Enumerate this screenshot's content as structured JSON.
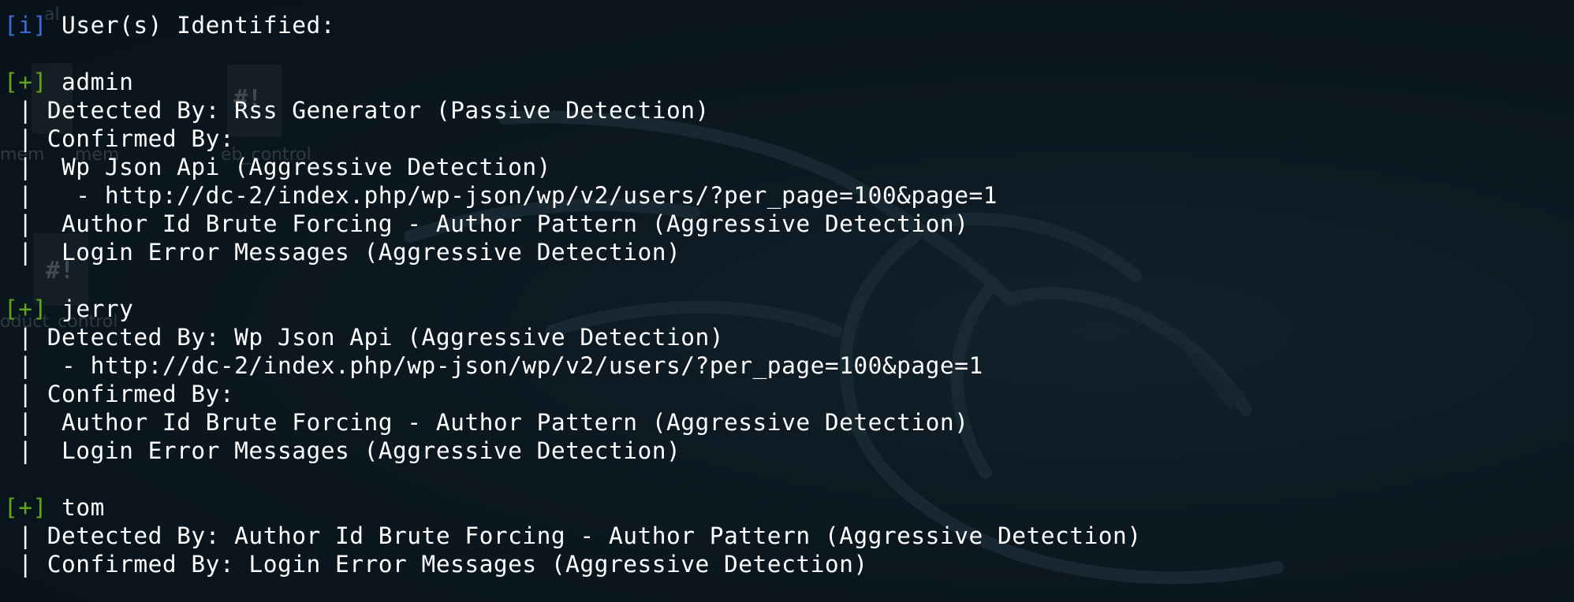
{
  "desktop_labels": [
    "al",
    "mem",
    "mem",
    "eb_control",
    "oduct_control"
  ],
  "lines": [
    {
      "tag": "[i]",
      "tag_kind": "info",
      "text": " User(s) Identified:"
    },
    {
      "tag": "",
      "tag_kind": "",
      "text": ""
    },
    {
      "tag": "[+]",
      "tag_kind": "plus",
      "text": " admin"
    },
    {
      "tag": "",
      "tag_kind": "",
      "text": " | Detected By: Rss Generator (Passive Detection)"
    },
    {
      "tag": "",
      "tag_kind": "",
      "text": " | Confirmed By:"
    },
    {
      "tag": "",
      "tag_kind": "",
      "text": " |  Wp Json Api (Aggressive Detection)"
    },
    {
      "tag": "",
      "tag_kind": "",
      "text": " |   - http://dc-2/index.php/wp-json/wp/v2/users/?per_page=100&page=1"
    },
    {
      "tag": "",
      "tag_kind": "",
      "text": " |  Author Id Brute Forcing - Author Pattern (Aggressive Detection)"
    },
    {
      "tag": "",
      "tag_kind": "",
      "text": " |  Login Error Messages (Aggressive Detection)"
    },
    {
      "tag": "",
      "tag_kind": "",
      "text": ""
    },
    {
      "tag": "[+]",
      "tag_kind": "plus",
      "text": " jerry"
    },
    {
      "tag": "",
      "tag_kind": "",
      "text": " | Detected By: Wp Json Api (Aggressive Detection)"
    },
    {
      "tag": "",
      "tag_kind": "",
      "text": " |  - http://dc-2/index.php/wp-json/wp/v2/users/?per_page=100&page=1"
    },
    {
      "tag": "",
      "tag_kind": "",
      "text": " | Confirmed By:"
    },
    {
      "tag": "",
      "tag_kind": "",
      "text": " |  Author Id Brute Forcing - Author Pattern (Aggressive Detection)"
    },
    {
      "tag": "",
      "tag_kind": "",
      "text": " |  Login Error Messages (Aggressive Detection)"
    },
    {
      "tag": "",
      "tag_kind": "",
      "text": ""
    },
    {
      "tag": "[+]",
      "tag_kind": "plus",
      "text": " tom"
    },
    {
      "tag": "",
      "tag_kind": "",
      "text": " | Detected By: Author Id Brute Forcing - Author Pattern (Aggressive Detection)"
    },
    {
      "tag": "",
      "tag_kind": "",
      "text": " | Confirmed By: Login Error Messages (Aggressive Detection)"
    }
  ],
  "colors": {
    "info_tag": "#3d6bd6",
    "plus_tag": "#5fa61d",
    "text": "#ffffff",
    "background": "#0a141c"
  }
}
